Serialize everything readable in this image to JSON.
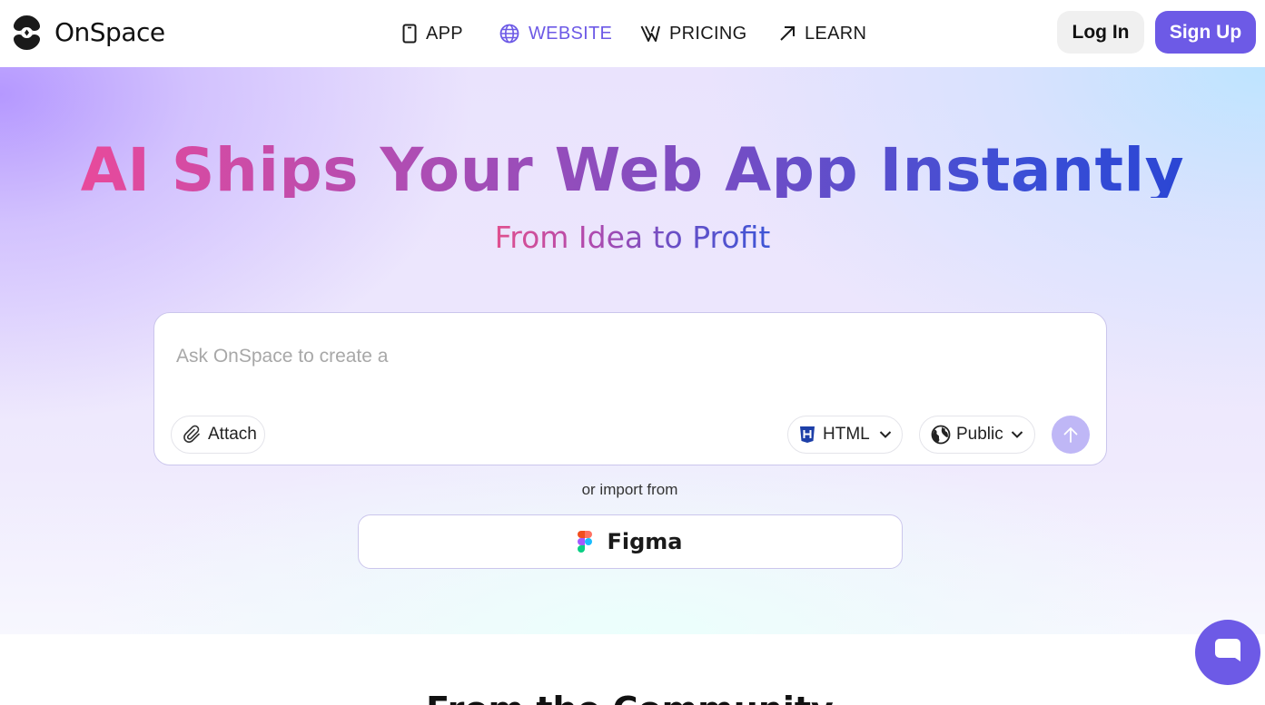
{
  "brand": {
    "name": "OnSpace",
    "accent": "#6d5ae6"
  },
  "nav": [
    {
      "label": "APP",
      "icon": "phone-icon",
      "active": false
    },
    {
      "label": "WEBSITE",
      "icon": "globe-icon",
      "active": true
    },
    {
      "label": "PRICING",
      "icon": "pricing-logo-icon",
      "active": false
    },
    {
      "label": "LEARN",
      "icon": "arrow-up-right-icon",
      "active": false
    }
  ],
  "auth": {
    "login_label": "Log In",
    "signup_label": "Sign Up"
  },
  "hero": {
    "title": "AI Ships Your Web App Instantly",
    "subtitle": "From Idea to Profit"
  },
  "prompt": {
    "placeholder": "Ask OnSpace to create a",
    "attach_label": "Attach",
    "format_label": "HTML",
    "visibility_label": "Public"
  },
  "import": {
    "label": "or import from",
    "figma_label": "Figma"
  },
  "section": {
    "title": "From the Community"
  }
}
